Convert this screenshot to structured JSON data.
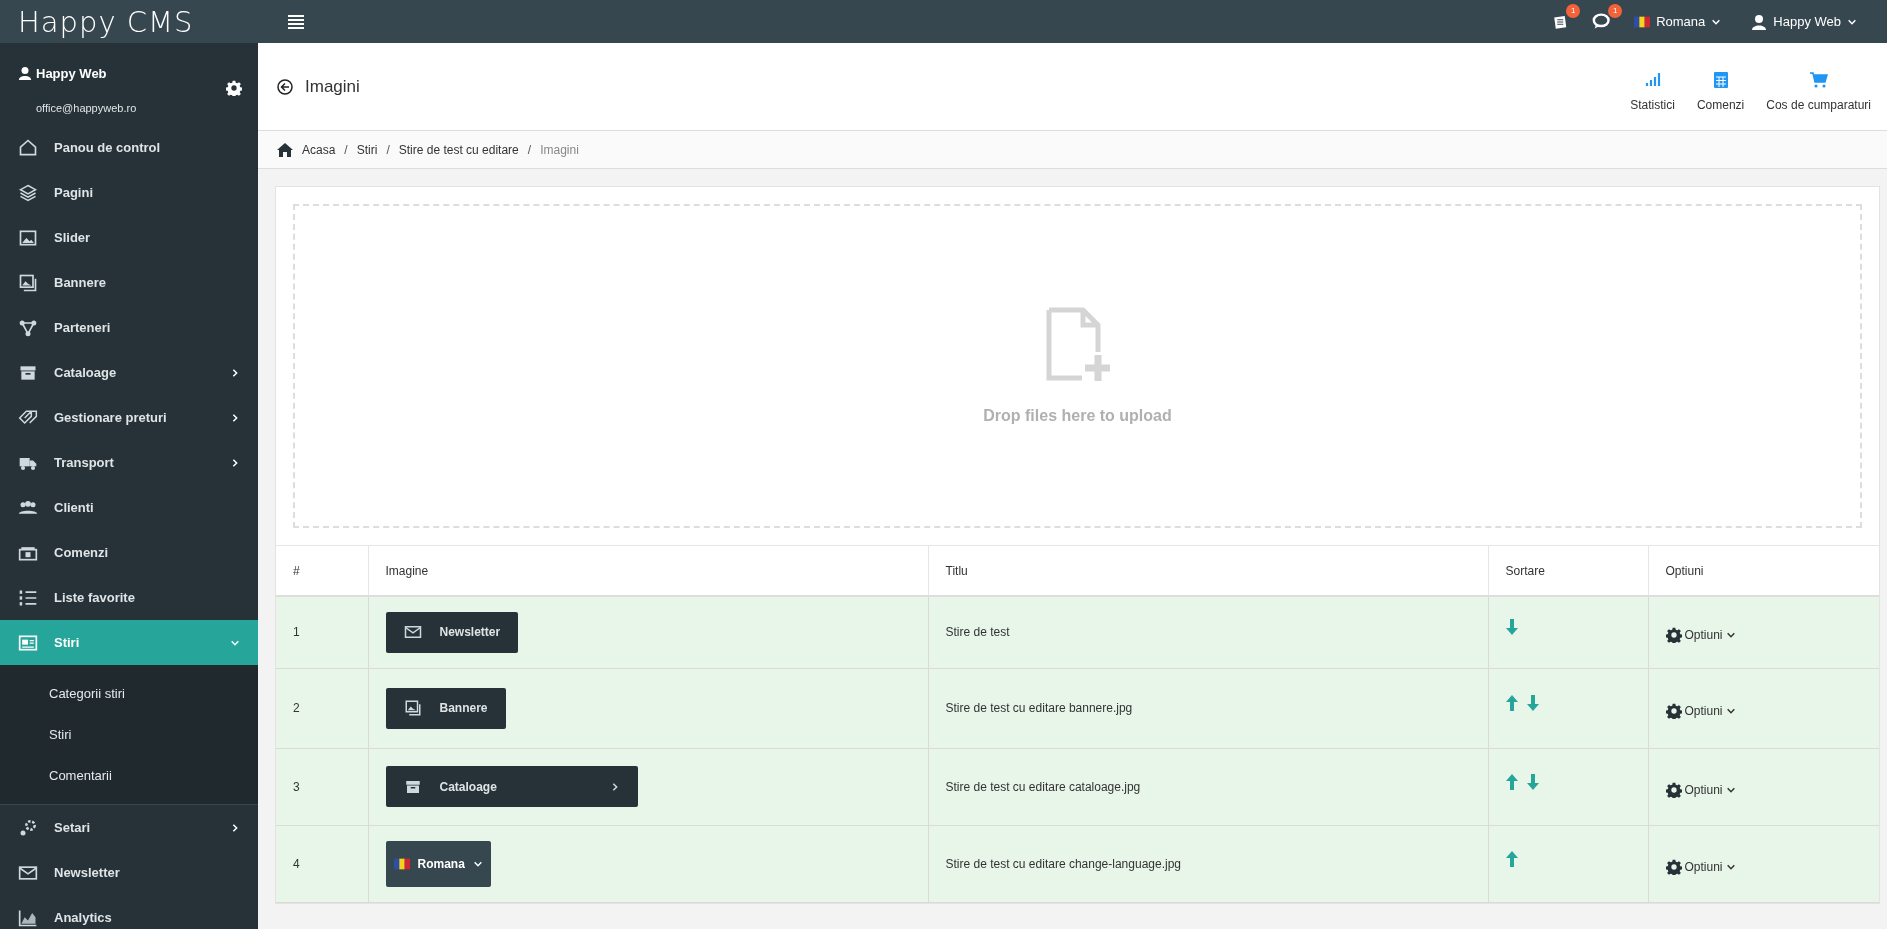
{
  "topbar": {
    "logo": "Happy CMS",
    "notifications": [
      {
        "kind": "news",
        "count": "1"
      },
      {
        "kind": "comments",
        "count": "1"
      }
    ],
    "language": "Romana",
    "user": "Happy Web"
  },
  "sidebar": {
    "user": {
      "name": "Happy Web",
      "email": "office@happyweb.ro"
    },
    "items": [
      {
        "label": "Panou de control",
        "selected": false,
        "has_submenu": false
      },
      {
        "label": "Pagini",
        "selected": false,
        "has_submenu": false
      },
      {
        "label": "Slider",
        "selected": false,
        "has_submenu": false
      },
      {
        "label": "Bannere",
        "selected": false,
        "has_submenu": false
      },
      {
        "label": "Parteneri",
        "selected": false,
        "has_submenu": false
      },
      {
        "label": "Cataloage",
        "selected": false,
        "has_submenu": true,
        "expanded": false
      },
      {
        "label": "Gestionare preturi",
        "selected": false,
        "has_submenu": true,
        "expanded": false
      },
      {
        "label": "Transport",
        "selected": false,
        "has_submenu": true,
        "expanded": false
      },
      {
        "label": "Clienti",
        "selected": false,
        "has_submenu": false
      },
      {
        "label": "Comenzi",
        "selected": false,
        "has_submenu": false
      },
      {
        "label": "Liste favorite",
        "selected": false,
        "has_submenu": false
      },
      {
        "label": "Stiri",
        "selected": true,
        "has_submenu": true,
        "expanded": true,
        "children": [
          {
            "label": "Categorii stiri"
          },
          {
            "label": "Stiri"
          },
          {
            "label": "Comentarii"
          }
        ]
      },
      {
        "label": "Setari",
        "selected": false,
        "has_submenu": true,
        "expanded": false
      },
      {
        "label": "Newsletter",
        "selected": false,
        "has_submenu": false
      },
      {
        "label": "Analytics",
        "selected": false,
        "has_submenu": false
      }
    ]
  },
  "header": {
    "title": "Imagini",
    "shortcuts": [
      {
        "label": "Statistici"
      },
      {
        "label": "Comenzi"
      },
      {
        "label": "Cos de cumparaturi"
      }
    ]
  },
  "breadcrumb": {
    "separator": "/",
    "items": [
      "Acasa",
      "Stiri",
      "Stire de test cu editare",
      "Imagini"
    ]
  },
  "dropzone": {
    "text": "Drop files here to upload"
  },
  "table": {
    "columns": [
      "#",
      "Imagine",
      "Titlu",
      "Sortare",
      "Optiuni"
    ],
    "rows": [
      {
        "index": "1",
        "image": {
          "kind": "plain",
          "label": "Newsletter"
        },
        "title": "Stire de test",
        "sort": {
          "up": false,
          "down": true
        },
        "options": "Optiuni"
      },
      {
        "index": "2",
        "image": {
          "kind": "plain",
          "label": "Bannere"
        },
        "title": "Stire de test cu editare bannere.jpg",
        "sort": {
          "up": true,
          "down": true
        },
        "options": "Optiuni"
      },
      {
        "index": "3",
        "image": {
          "kind": "submenu",
          "label": "Cataloage"
        },
        "title": "Stire de test cu editare cataloage.jpg",
        "sort": {
          "up": true,
          "down": true
        },
        "options": "Optiuni"
      },
      {
        "index": "4",
        "image": {
          "kind": "language",
          "label": "Romana"
        },
        "title": "Stire de test cu editare change-language.jpg",
        "sort": {
          "up": true,
          "down": false
        },
        "options": "Optiuni"
      }
    ]
  }
}
